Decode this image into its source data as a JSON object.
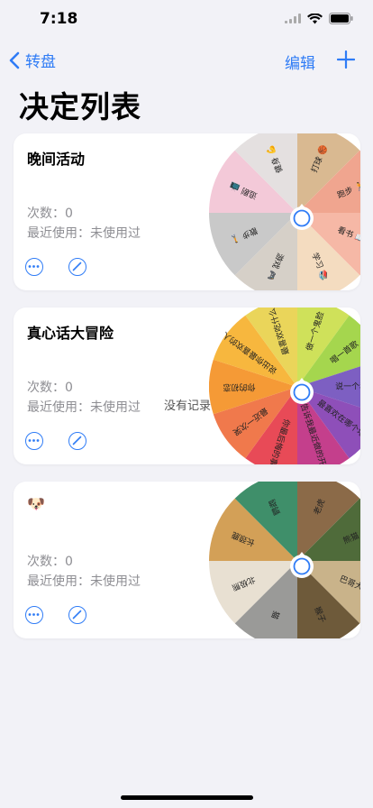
{
  "status": {
    "time": "7:18"
  },
  "nav": {
    "back_label": "转盘",
    "edit_label": "编辑"
  },
  "page": {
    "title": "决定列表"
  },
  "cards": [
    {
      "title": "晚间活动",
      "count": "次数：0",
      "last_used": "最近使用：未使用过",
      "wheel_labels": [
        "打球 🏀",
        "跑步 🏃",
        "看书 📖",
        "学习 📚",
        "游戏 🎮",
        "散步 🚶",
        "追剧 📺",
        "健身 💪"
      ],
      "wheel_colors": [
        "#d9b991",
        "#f0a58f",
        "#f6b8a6",
        "#f4dcc0",
        "#d6d0c8",
        "#c9c9c9",
        "#f3c9d8",
        "#e4e0e0"
      ]
    },
    {
      "title": "真心话大冒险",
      "count": "次数：0",
      "last_used": "最近使用：未使用过",
      "no_record": "没有记录",
      "wheel_labels": [
        "做一个鬼脸",
        "唱一首歌",
        "说一个秘密",
        "最喜欢在哪个地方",
        "告诉我最近做的开心事",
        "你最后悔的事",
        "最近一次哭",
        "你的初恋",
        "说出你最喜欢的人",
        "最喜欢吃什么"
      ],
      "wheel_colors": [
        "#cfe15a",
        "#a5d64e",
        "#7d5fc2",
        "#8e4fb9",
        "#c43f8c",
        "#e84a57",
        "#f0794c",
        "#f59a36",
        "#f7b73e",
        "#ead55a"
      ]
    },
    {
      "title": "🐶",
      "count": "次数：0",
      "last_used": "最近使用：未使用过",
      "wheel_labels": [
        "老虎",
        "熊猫",
        "巴哥犬",
        "猴子",
        "猫",
        "北极熊",
        "长颈鹿",
        "鹦鹉"
      ],
      "wheel_colors": [
        "#8b6a48",
        "#4f6b3a",
        "#c9b38a",
        "#6e5a3a",
        "#9a9a98",
        "#e8e0d2",
        "#d3a057",
        "#3f8f6a"
      ]
    }
  ]
}
